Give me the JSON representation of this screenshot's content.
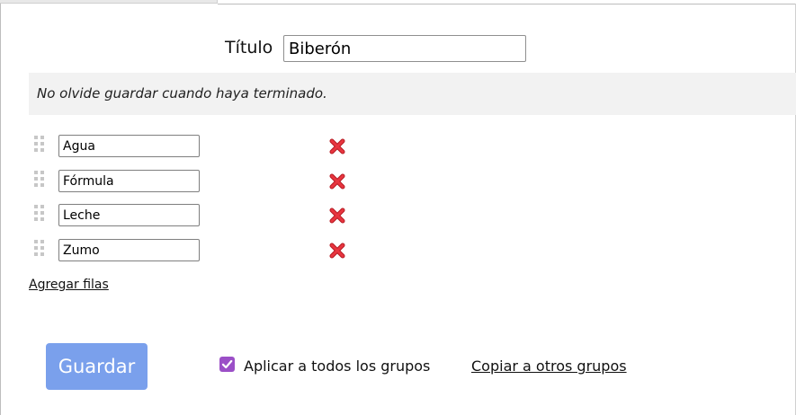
{
  "form": {
    "title_label": "Título",
    "title_value": "Biberón",
    "notice": "No olvide guardar cuando haya terminado."
  },
  "items": [
    {
      "value": "Agua",
      "drag_icon": "drag-handle-icon",
      "delete_icon": "delete-x-icon"
    },
    {
      "value": "Fórmula",
      "drag_icon": "drag-handle-icon",
      "delete_icon": "delete-x-icon"
    },
    {
      "value": "Leche",
      "drag_icon": "drag-handle-icon",
      "delete_icon": "delete-x-icon"
    },
    {
      "value": "Zumo",
      "drag_icon": "drag-handle-icon",
      "delete_icon": "delete-x-icon"
    }
  ],
  "actions": {
    "add_rows": "Agregar filas",
    "save": "Guardar",
    "apply_all": "Aplicar a todos los grupos",
    "apply_all_checked": true,
    "copy_to_other": "Copiar a otros grupos"
  },
  "colors": {
    "save_button": "#7aa0ec",
    "checkbox": "#9b4fc7",
    "delete_icon": "#e0303a",
    "notice_background": "#f2f2f2"
  }
}
